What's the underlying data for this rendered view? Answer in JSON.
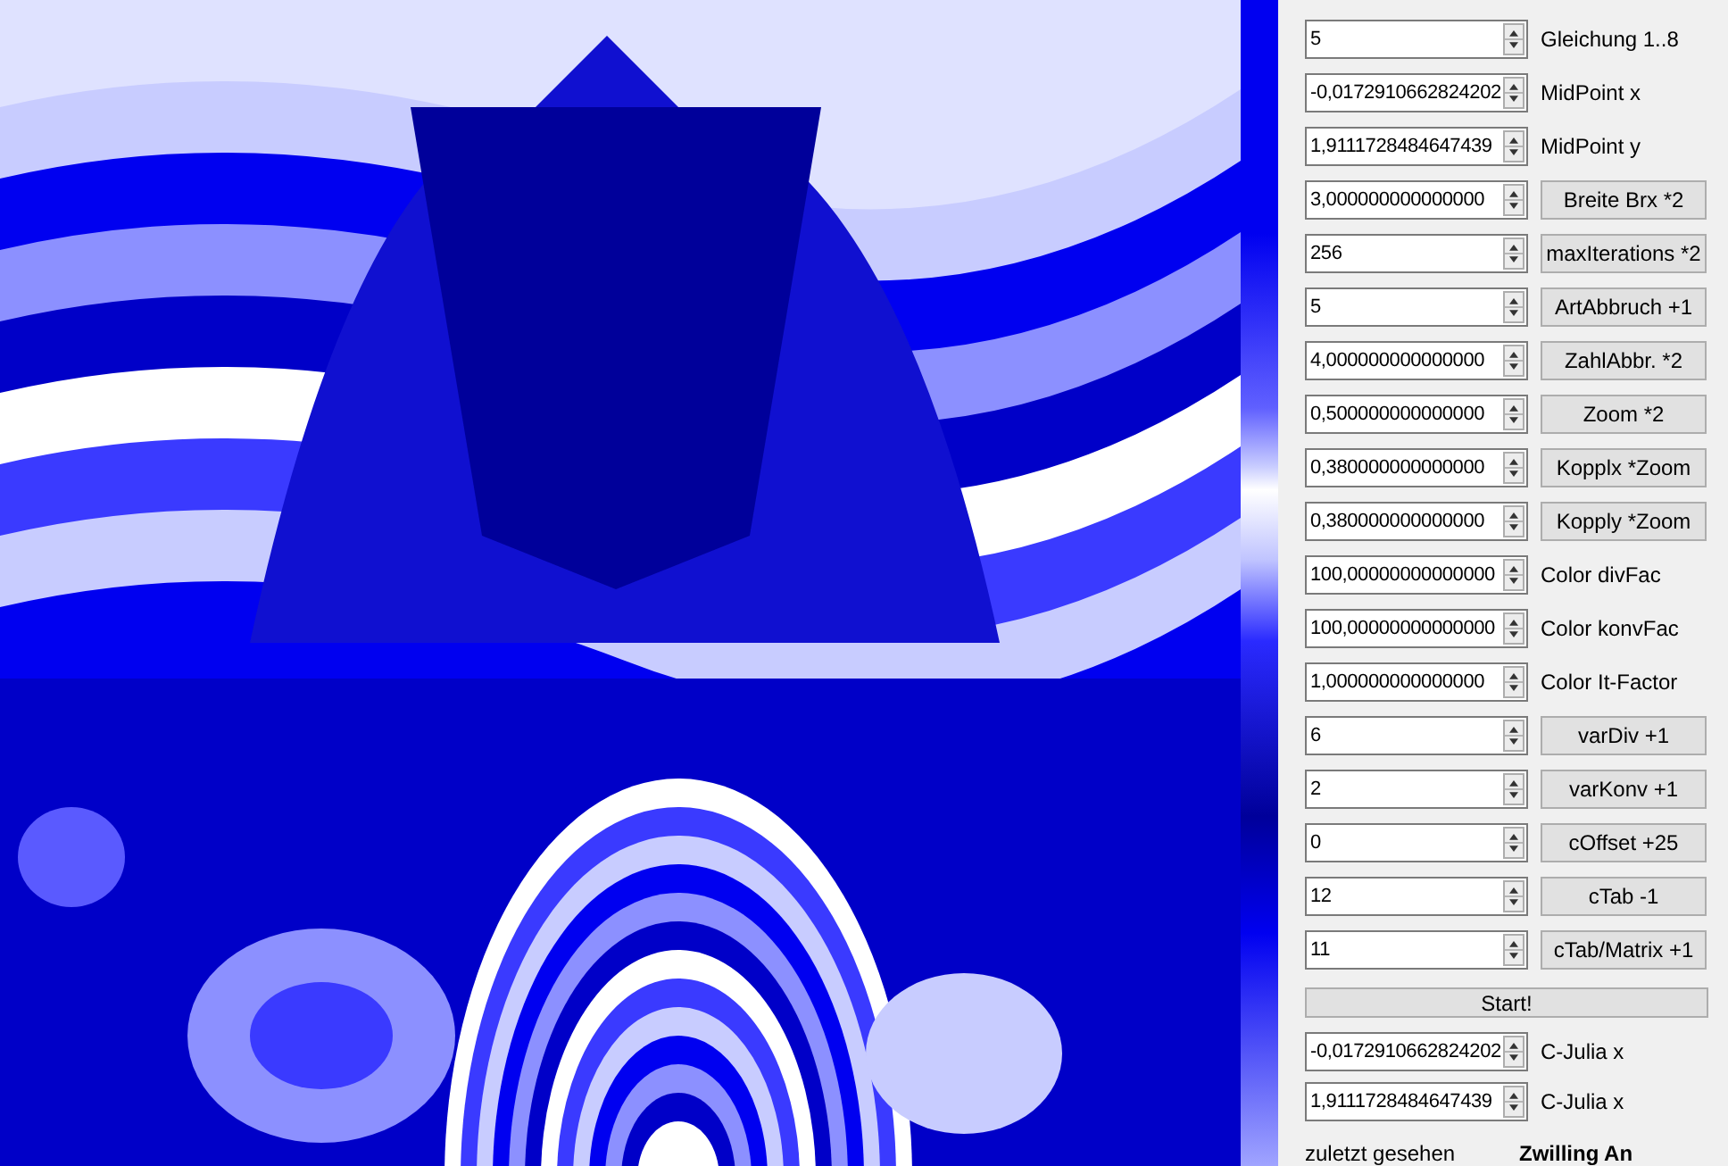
{
  "controls": [
    {
      "value": "5",
      "kind": "label",
      "text": "Gleichung 1..8"
    },
    {
      "value": "-0,0172910662824202",
      "kind": "label",
      "text": "MidPoint x"
    },
    {
      "value": "1,9111728484647439",
      "kind": "label",
      "text": "MidPoint y"
    },
    {
      "value": "3,000000000000000",
      "kind": "button",
      "text": "Breite Brx *2"
    },
    {
      "value": "256",
      "kind": "button",
      "text": "maxIterations *2"
    },
    {
      "value": "5",
      "kind": "button",
      "text": "ArtAbbruch +1"
    },
    {
      "value": "4,000000000000000",
      "kind": "button",
      "text": "ZahlAbbr. *2"
    },
    {
      "value": "0,500000000000000",
      "kind": "button",
      "text": "Zoom *2"
    },
    {
      "value": "0,380000000000000",
      "kind": "button",
      "text": "Kopplx *Zoom"
    },
    {
      "value": "0,380000000000000",
      "kind": "button",
      "text": "Kopply *Zoom"
    },
    {
      "value": "100,00000000000000",
      "kind": "label",
      "text": "Color divFac"
    },
    {
      "value": "100,00000000000000",
      "kind": "label",
      "text": "Color konvFac"
    },
    {
      "value": "1,000000000000000",
      "kind": "label",
      "text": "Color It-Factor"
    },
    {
      "value": "6",
      "kind": "button",
      "text": "varDiv +1"
    },
    {
      "value": "2",
      "kind": "button",
      "text": "varKonv +1"
    },
    {
      "value": "0",
      "kind": "button",
      "text": "cOffset +25"
    },
    {
      "value": "12",
      "kind": "button",
      "text": "cTab -1"
    },
    {
      "value": "11",
      "kind": "button",
      "text": "cTab/Matrix +1"
    }
  ],
  "start_button": "Start!",
  "julia_controls": [
    {
      "value": "-0,0172910662824202",
      "kind": "label",
      "text": "C-Julia x"
    },
    {
      "value": "1,9111728484647439",
      "kind": "label",
      "text": "C-Julia x"
    }
  ],
  "status": {
    "caption": "zuletzt gesehen",
    "value": "Zwilling An"
  }
}
